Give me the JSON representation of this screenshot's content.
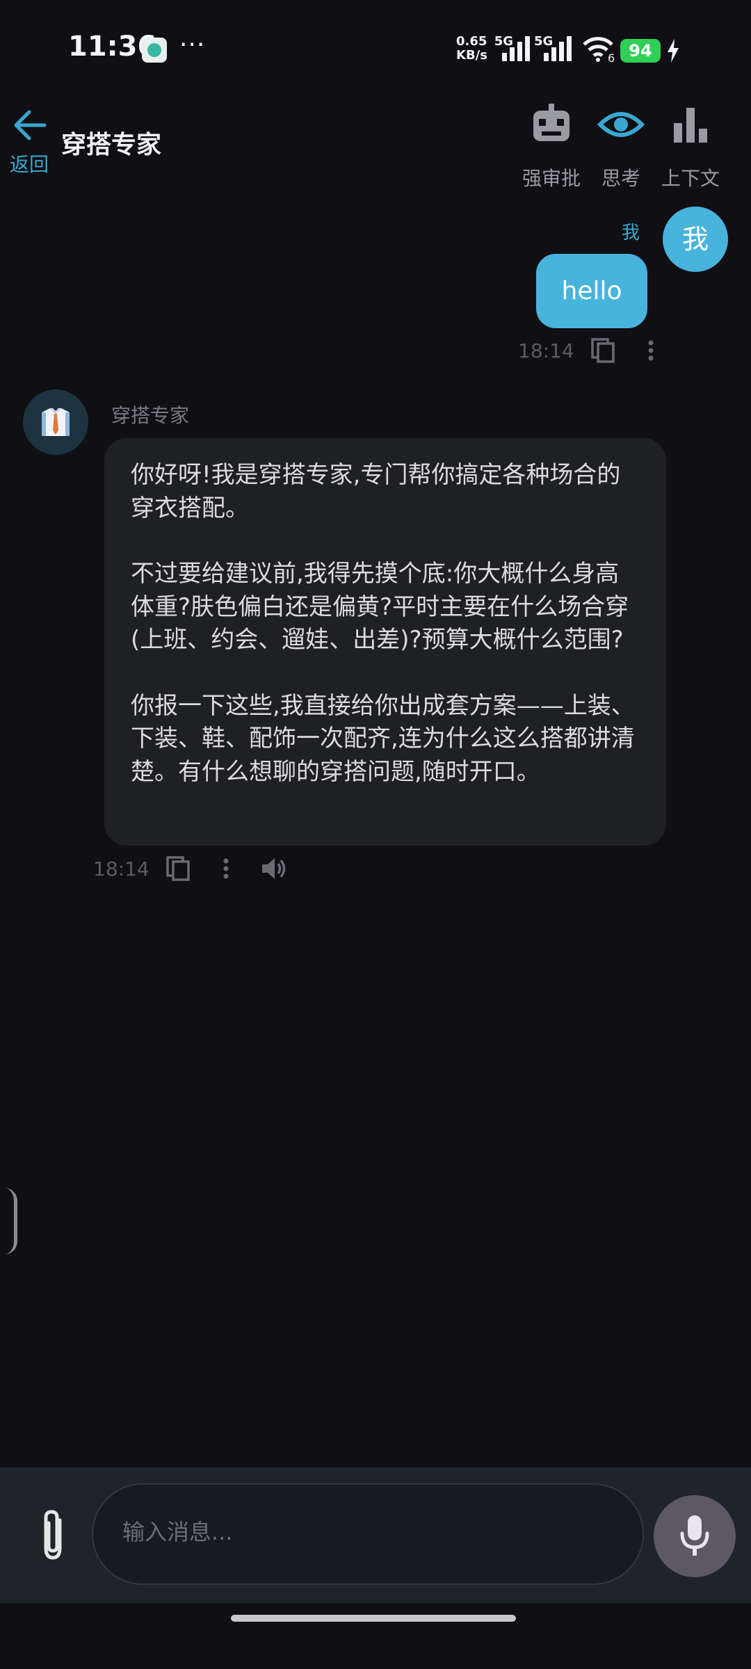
{
  "status_bar": {
    "time": "11:36",
    "more": "···",
    "net_speed_value": "0.65",
    "net_speed_unit": "KB/s",
    "net_type_1": "5G",
    "net_type_2": "5G",
    "wifi_badge": "6",
    "battery": "94",
    "colors": {
      "battery": "#2fcf55"
    }
  },
  "header": {
    "back_label": "返回",
    "title": "穿搭专家",
    "actions": [
      {
        "label": "强审批",
        "icon": "robot-icon"
      },
      {
        "label": "思考",
        "icon": "eye-icon"
      },
      {
        "label": "上下文",
        "icon": "bar-chart-icon"
      }
    ]
  },
  "messages": [
    {
      "role": "user",
      "sender": "我",
      "avatar_text": "我",
      "text": "hello",
      "time": "18:14"
    },
    {
      "role": "assistant",
      "sender": "穿搭专家",
      "avatar_icon": "shirt-tie-icon",
      "paragraphs": [
        "你好呀!我是穿搭专家,专门帮你搞定各种场合的穿衣搭配。",
        "不过要给建议前,我得先摸个底:你大概什么身高体重?肤色偏白还是偏黄?平时主要在什么场合穿(上班、约会、遛娃、出差)?预算大概什么范围?",
        "你报一下这些,我直接给你出成套方案——上装、下装、鞋、配饰一次配齐,连为什么这么搭都讲清楚。有什么想聊的穿搭问题,随时开口。"
      ],
      "time": "18:14"
    }
  ],
  "composer": {
    "placeholder": "输入消息..."
  },
  "theme": {
    "accent": "#48b4dc",
    "background": "#0f0f14",
    "bubble_bot": "#1f2024"
  }
}
